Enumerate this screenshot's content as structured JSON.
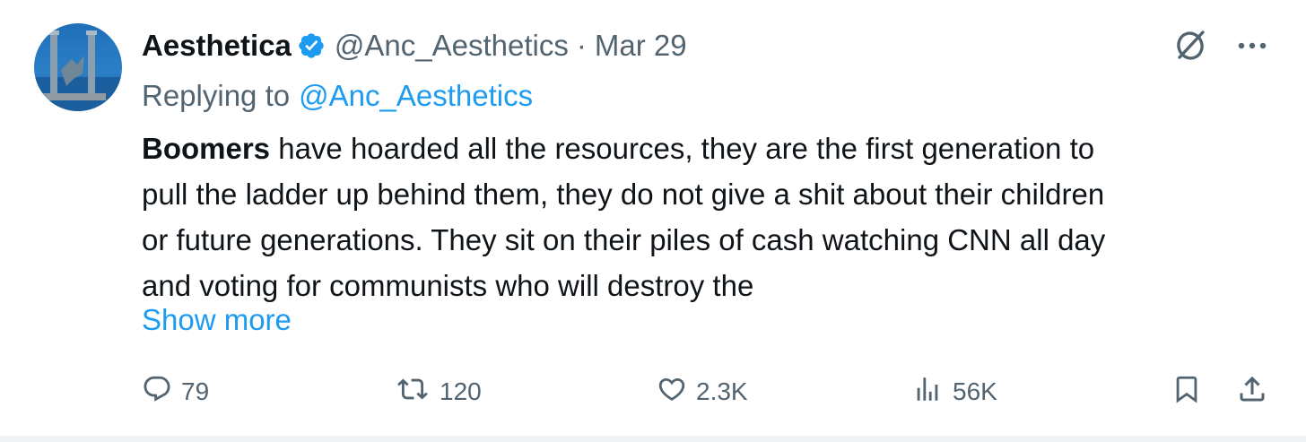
{
  "tweet": {
    "author_name": "Aesthetica",
    "handle": "@Anc_Aesthetics",
    "separator": "·",
    "date": "Mar 29",
    "replying_prefix": "Replying to",
    "replying_to": "@Anc_Aesthetics",
    "body_bold": "Boomers",
    "body_lines": [
      " have hoarded all the resources, they are the first generation to",
      "pull the ladder up behind them, they do not give a shit about their children",
      "or future generations. They sit on their piles of cash watching CNN all day",
      "and voting for communists who will destroy the"
    ],
    "show_more": "Show more"
  },
  "actions": {
    "replies": "79",
    "reposts": "120",
    "likes": "2.3K",
    "views": "56K"
  },
  "icons": {
    "verified": "verified-badge-icon",
    "grok": "grok-icon",
    "more": "more-icon",
    "reply": "reply-icon",
    "repost": "repost-icon",
    "like": "heart-icon",
    "views": "views-icon",
    "bookmark": "bookmark-icon",
    "share": "share-icon"
  },
  "colors": {
    "text": "#0f1419",
    "secondary": "#536471",
    "accent": "#1d9bf0",
    "divider": "#eff3f4"
  }
}
